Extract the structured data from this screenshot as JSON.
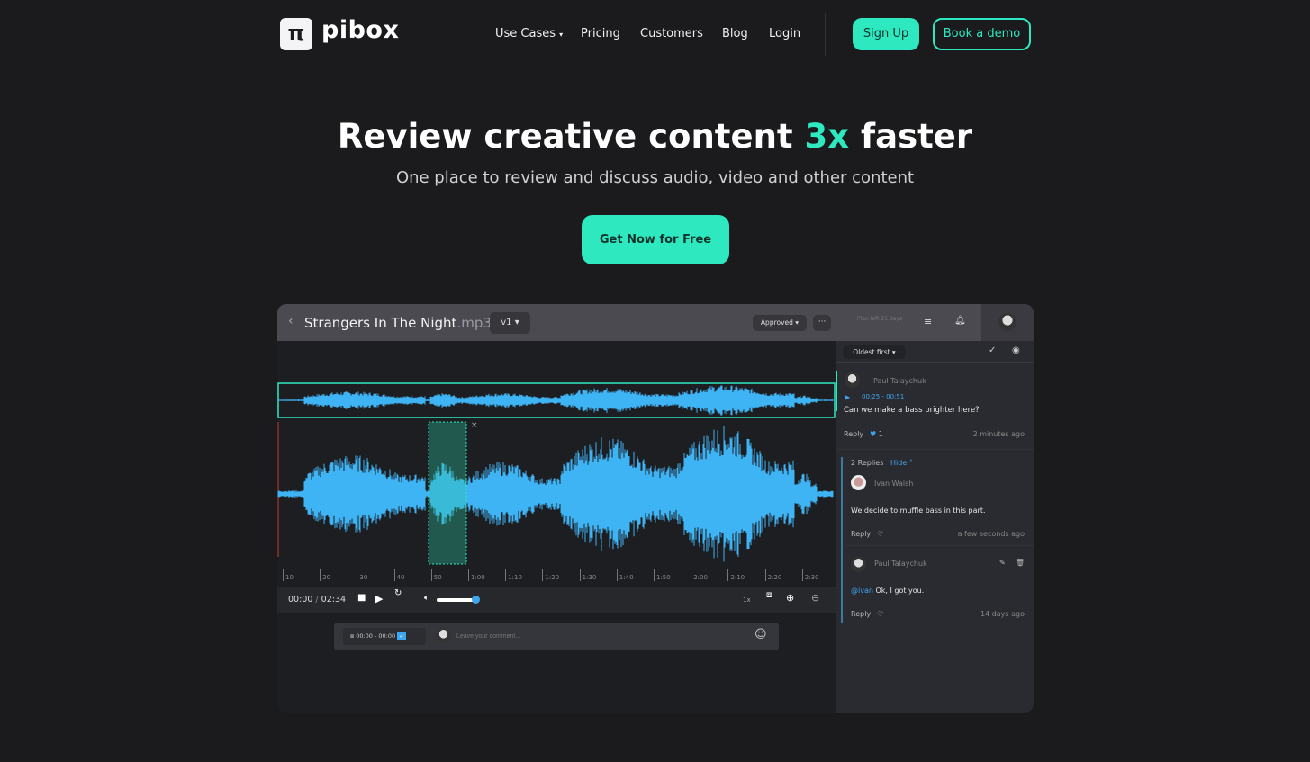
{
  "brand": {
    "logo_glyph": "π",
    "name": "pibox",
    "accent": "#2ee8c0"
  },
  "nav": {
    "items": [
      "Use Cases",
      "Pricing",
      "Customers",
      "Blog",
      "Login"
    ],
    "signup": "Sign Up",
    "demo": "Book a demo"
  },
  "hero": {
    "title_pre": "Review creative content ",
    "title_accent": "3x",
    "title_post": " faster",
    "subtitle": "One place to review and discuss audio, video and other content",
    "cta": "Get Now for Free"
  },
  "app": {
    "file_name": "Strangers In The Night",
    "file_ext": ".mp3",
    "version": "v1",
    "status": "Approved",
    "plan": "Plan left 25 days",
    "timeline": [
      "10",
      "20",
      "30",
      "40",
      "50",
      "1:00",
      "1:10",
      "1:20",
      "1:30",
      "1:40",
      "1:50",
      "2:00",
      "2:10",
      "2:20",
      "2:30"
    ],
    "player": {
      "current": "00:00",
      "separator": "/",
      "duration": "02:34",
      "speed": "1x",
      "volume": 0.9
    },
    "waveform_color": "#3fb4f5",
    "comment_bar": {
      "range": "00:00 - 00:00",
      "placeholder": "Leave your comment..."
    },
    "comments": {
      "sort": "Oldest first",
      "main": {
        "author": "Paul Talaychuk",
        "range": "00:25 - 00:51",
        "text": "Can we make a bass brighter here?",
        "reply": "Reply",
        "likes": "1",
        "time": "2 minutes ago"
      },
      "replies_count": "2 Replies",
      "hide": "Hide",
      "replies": [
        {
          "author": "Ivan Walsh",
          "mention": "",
          "text": "We decide to muffle bass in this part.",
          "reply": "Reply",
          "time": "a few seconds ago"
        },
        {
          "author": "Paul Talaychuk",
          "mention": "@ivan",
          "text": " Ok, I got you.",
          "reply": "Reply",
          "time": "14 days ago"
        }
      ]
    }
  }
}
